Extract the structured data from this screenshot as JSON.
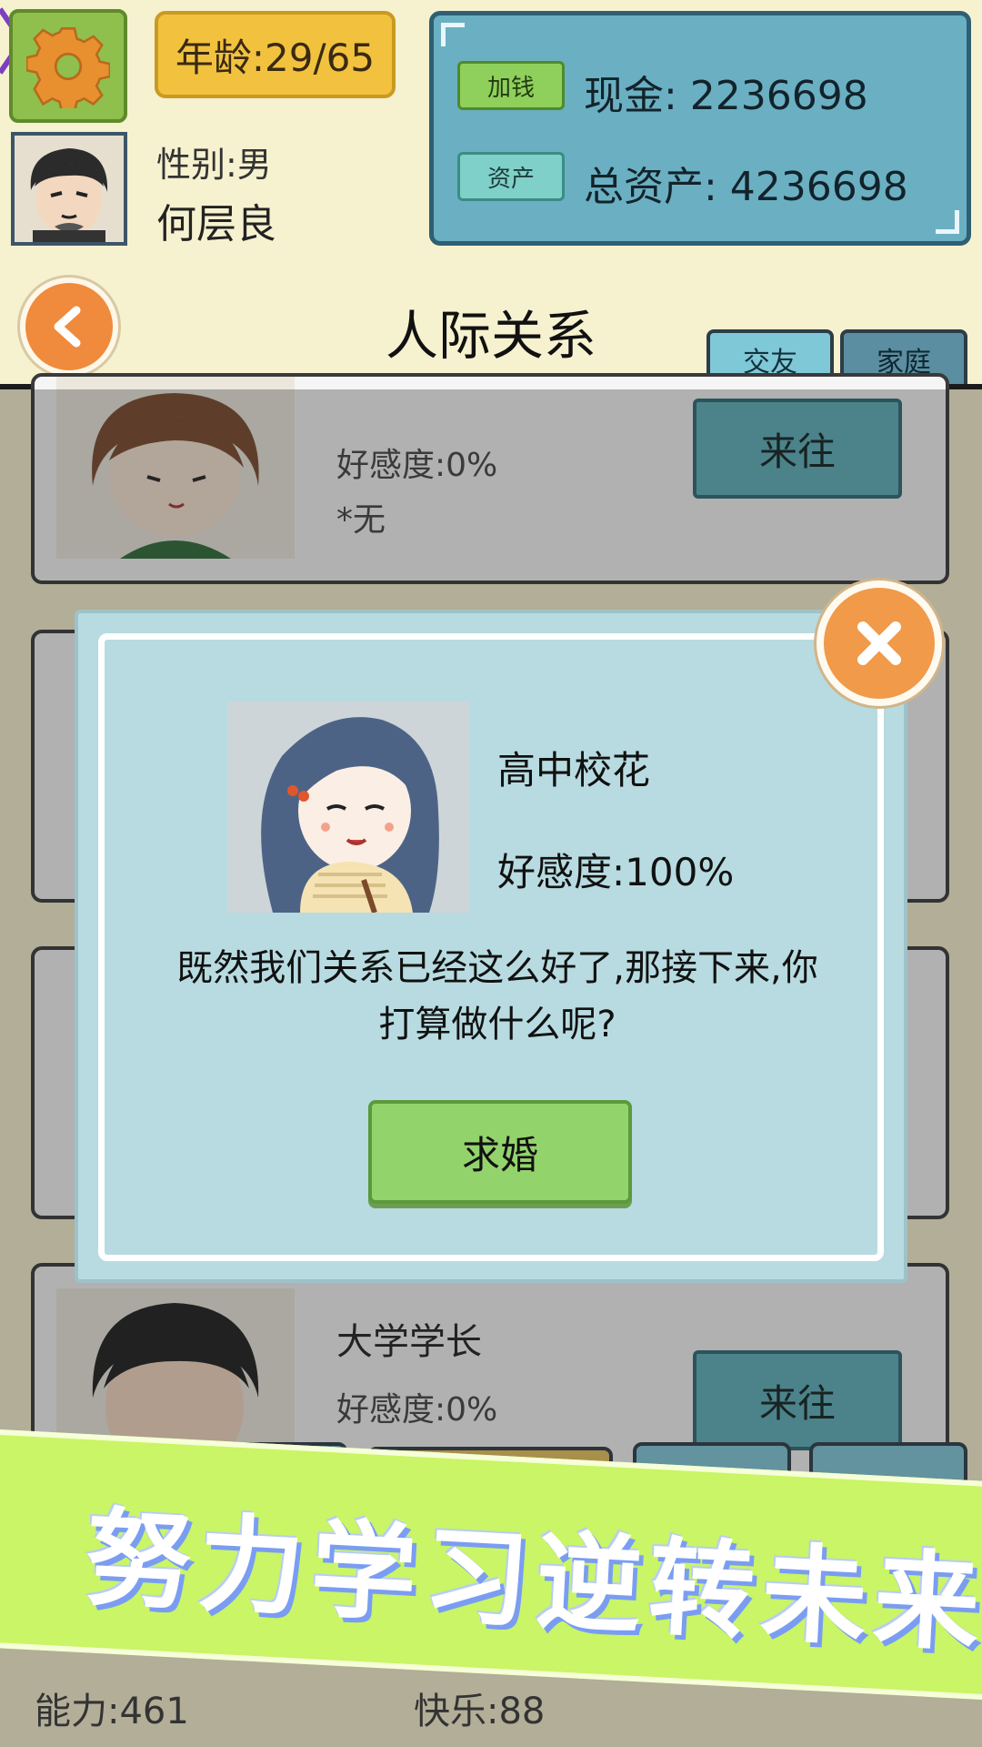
{
  "header": {
    "age": "年龄:29/65",
    "gender": "性别:男",
    "name": "何层良",
    "add_money_label": "加钱",
    "assets_label": "资产",
    "cash": "现金: 2236698",
    "total_assets": "总资产: 4236698"
  },
  "page": {
    "title": "人际关系",
    "tabs": [
      "交友",
      "家庭"
    ],
    "active_tab": "交友"
  },
  "list": [
    {
      "name": "",
      "affinity": "好感度:0%",
      "note": "*无",
      "action": "来往"
    },
    {
      "name": "大学学长",
      "affinity": "好感度:0%",
      "note": "",
      "action": "来往"
    }
  ],
  "modal": {
    "name": "高中校花",
    "affinity": "好感度:100%",
    "question": "既然我们关系已经这么好了,那接下来,你打算做什么呢?",
    "action": "求婚"
  },
  "stats": {
    "ability": "能力:461",
    "happiness": "快乐:88"
  },
  "banner": {
    "text": "努力学习逆转未来"
  },
  "colors": {
    "background": "#f6f1cf",
    "money_panel": "#6ab0c2",
    "modal": "#b7dbe0",
    "propose_button": "#93d36c",
    "close_button": "#f09a4a",
    "banner": "#c9f566"
  },
  "icons": {
    "settings": "gear-icon",
    "back": "back-arrow-icon",
    "close": "close-icon"
  }
}
